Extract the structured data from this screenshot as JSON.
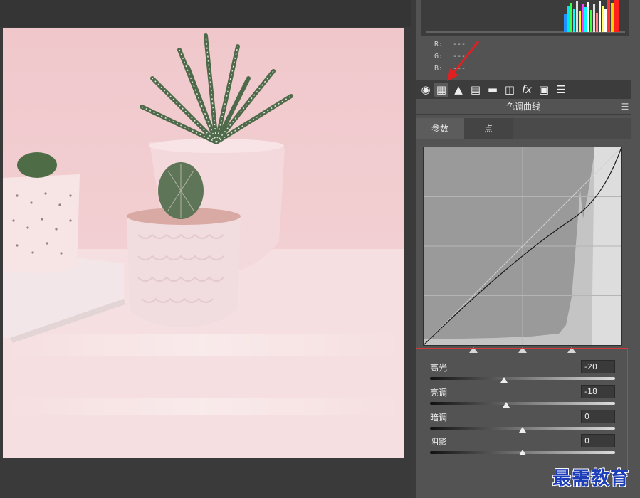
{
  "histogram": {
    "readout": [
      {
        "channel": "R:",
        "value": "---"
      },
      {
        "channel": "G:",
        "value": "---"
      },
      {
        "channel": "B:",
        "value": "---"
      }
    ]
  },
  "toolbar": {
    "tools": [
      {
        "name": "basic-icon",
        "glyph": "◉"
      },
      {
        "name": "tone-curve-icon",
        "glyph": "▦"
      },
      {
        "name": "detail-icon",
        "glyph": "▲"
      },
      {
        "name": "hsl-icon",
        "glyph": "▤"
      },
      {
        "name": "split-toning-icon",
        "glyph": "▬"
      },
      {
        "name": "lens-corrections-icon",
        "glyph": "◫"
      },
      {
        "name": "effects-icon",
        "glyph": "fx"
      },
      {
        "name": "camera-calibration-icon",
        "glyph": "▣"
      },
      {
        "name": "presets-icon",
        "glyph": "☰"
      }
    ]
  },
  "panel": {
    "title": "色调曲线",
    "tabs": [
      "参数",
      "点"
    ]
  },
  "sliders": [
    {
      "label": "高光",
      "value": "-20",
      "level": -20
    },
    {
      "label": "亮调",
      "value": "-18",
      "level": -18
    },
    {
      "label": "暗调",
      "value": "0",
      "level": 0
    },
    {
      "label": "阴影",
      "value": "0",
      "level": 0
    }
  ],
  "watermark": "最需教育",
  "colors": {
    "accent_red": "#d23a3a",
    "watermark_blue": "#1e3db8"
  }
}
